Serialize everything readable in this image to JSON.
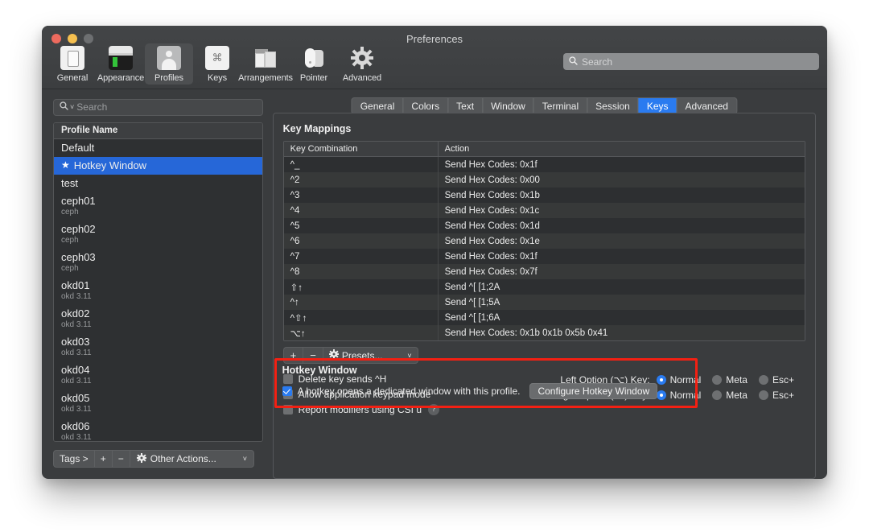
{
  "window": {
    "title": "Preferences",
    "traffic_lights": [
      "close",
      "minimize",
      "zoom"
    ]
  },
  "toolbar": {
    "items": [
      {
        "label": "General",
        "icon": "general-icon",
        "selected": false
      },
      {
        "label": "Appearance",
        "icon": "appearance-icon",
        "selected": false
      },
      {
        "label": "Profiles",
        "icon": "profiles-icon",
        "selected": true
      },
      {
        "label": "Keys",
        "icon": "keys-icon",
        "selected": false
      },
      {
        "label": "Arrangements",
        "icon": "arrangements-icon",
        "selected": false
      },
      {
        "label": "Pointer",
        "icon": "pointer-icon",
        "selected": false
      },
      {
        "label": "Advanced",
        "icon": "advanced-icon",
        "selected": false
      }
    ],
    "search": {
      "placeholder": "Search",
      "value": "",
      "icon": "search-icon"
    }
  },
  "sidebar": {
    "search": {
      "placeholder": "Search",
      "value": "",
      "icon": "search-icon"
    },
    "column_header": "Profile Name",
    "profiles": [
      {
        "name": "Default",
        "tag": "",
        "selected": false,
        "starred": false,
        "dot": false
      },
      {
        "name": "Hotkey Window",
        "tag": "",
        "selected": true,
        "starred": true,
        "dot": false
      },
      {
        "name": "test",
        "tag": "",
        "selected": false,
        "starred": false,
        "dot": false
      },
      {
        "name": "ceph01",
        "tag": "ceph",
        "selected": false,
        "starred": false,
        "dot": false
      },
      {
        "name": "ceph02",
        "tag": "ceph",
        "selected": false,
        "starred": false,
        "dot": false
      },
      {
        "name": "ceph03",
        "tag": "ceph",
        "selected": false,
        "starred": false,
        "dot": false
      },
      {
        "name": "okd01",
        "tag": "okd 3.11",
        "selected": false,
        "starred": false,
        "dot": true
      },
      {
        "name": "okd02",
        "tag": "okd 3.11",
        "selected": false,
        "starred": false,
        "dot": false
      },
      {
        "name": "okd03",
        "tag": "okd 3.11",
        "selected": false,
        "starred": false,
        "dot": false
      },
      {
        "name": "okd04",
        "tag": "okd 3.11",
        "selected": false,
        "starred": false,
        "dot": false
      },
      {
        "name": "okd05",
        "tag": "okd 3.11",
        "selected": false,
        "starred": false,
        "dot": false
      },
      {
        "name": "okd06",
        "tag": "okd 3.11",
        "selected": false,
        "starred": false,
        "dot": false
      }
    ],
    "toolbar": {
      "tags_label": "Tags >",
      "add_label": "+",
      "remove_label": "−",
      "other_actions_label": "Other Actions...",
      "chevron": "˅"
    }
  },
  "tabs": [
    {
      "label": "General",
      "active": false
    },
    {
      "label": "Colors",
      "active": false
    },
    {
      "label": "Text",
      "active": false
    },
    {
      "label": "Window",
      "active": false
    },
    {
      "label": "Terminal",
      "active": false
    },
    {
      "label": "Session",
      "active": false
    },
    {
      "label": "Keys",
      "active": true
    },
    {
      "label": "Advanced",
      "active": false
    }
  ],
  "key_mappings": {
    "section_title": "Key Mappings",
    "columns": [
      "Key Combination",
      "Action"
    ],
    "rows": [
      {
        "combo": "^_",
        "action": "Send Hex Codes: 0x1f"
      },
      {
        "combo": "^2",
        "action": "Send Hex Codes: 0x00"
      },
      {
        "combo": "^3",
        "action": "Send Hex Codes: 0x1b"
      },
      {
        "combo": "^4",
        "action": "Send Hex Codes: 0x1c"
      },
      {
        "combo": "^5",
        "action": "Send Hex Codes: 0x1d"
      },
      {
        "combo": "^6",
        "action": "Send Hex Codes: 0x1e"
      },
      {
        "combo": "^7",
        "action": "Send Hex Codes: 0x1f"
      },
      {
        "combo": "^8",
        "action": "Send Hex Codes: 0x7f"
      },
      {
        "combo": "⇧↑",
        "action": "Send ^[ [1;2A"
      },
      {
        "combo": "^↑",
        "action": "Send ^[ [1;5A"
      },
      {
        "combo": "^⇧↑",
        "action": "Send ^[ [1;6A"
      },
      {
        "combo": "⌥↑",
        "action": "Send Hex Codes: 0x1b 0x1b 0x5b 0x41"
      }
    ],
    "controls": {
      "add_label": "+",
      "remove_label": "−",
      "presets_label": "Presets...",
      "chevron": "˅"
    }
  },
  "options": {
    "checkboxes": [
      {
        "label": "Delete key sends ^H",
        "checked": false,
        "help": false
      },
      {
        "label": "Allow application keypad mode",
        "checked": false,
        "help": false
      },
      {
        "label": "Report modifiers using CSI u",
        "checked": false,
        "help": true,
        "help_glyph": "?"
      }
    ],
    "option_keys": [
      {
        "label": "Left Option (⌥) Key:",
        "choices": [
          {
            "label": "Normal",
            "selected": true
          },
          {
            "label": "Meta",
            "selected": false
          },
          {
            "label": "Esc+",
            "selected": false
          }
        ]
      },
      {
        "label": "Right Option (⌥) Key:",
        "choices": [
          {
            "label": "Normal",
            "selected": true
          },
          {
            "label": "Meta",
            "selected": false
          },
          {
            "label": "Esc+",
            "selected": false
          }
        ]
      }
    ]
  },
  "hotkey_window": {
    "title": "Hotkey Window",
    "checkbox_label": "A hotkey opens a dedicated window with this profile.",
    "checked": true,
    "button_label": "Configure Hotkey Window",
    "highlight_color": "#f32013"
  },
  "colors": {
    "accent_blue": "#2a7bf0",
    "selection_blue": "#2667d8",
    "window_bg": "#3a3c3e",
    "table_bg": "#2e3032",
    "highlight_red": "#f32013"
  }
}
